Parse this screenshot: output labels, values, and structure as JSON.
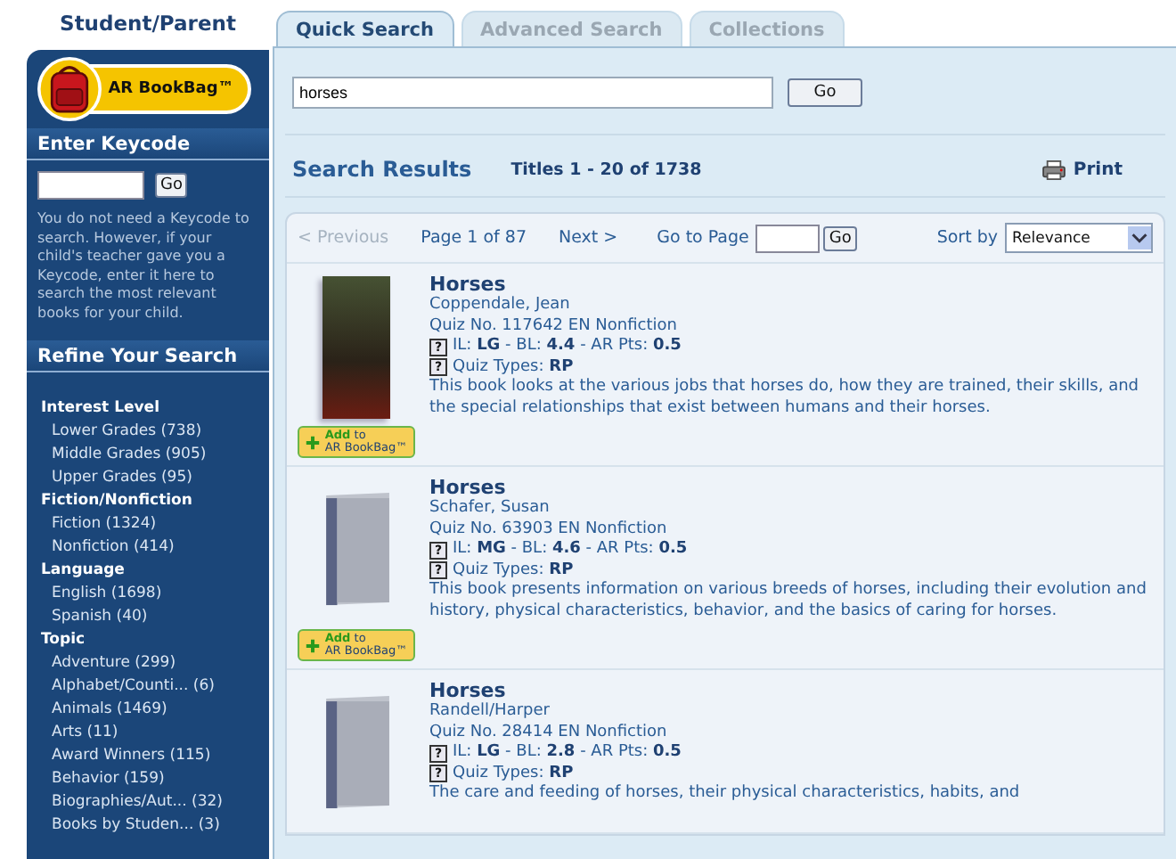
{
  "header": {
    "title": "Student/Parent"
  },
  "sidebar": {
    "bookbag": {
      "label": "AR BookBag™"
    },
    "keycode": {
      "title": "Enter Keycode",
      "button": "Go",
      "help": "You do not need a Keycode to search. However, if your child's teacher gave you a Keycode, enter it here to search the most relevant books for your child."
    },
    "refine": {
      "title": "Refine Your Search",
      "groups": [
        {
          "title": "Interest Level",
          "items": [
            "Lower Grades (738)",
            "Middle Grades (905)",
            "Upper Grades (95)"
          ]
        },
        {
          "title": "Fiction/Nonfiction",
          "items": [
            "Fiction (1324)",
            "Nonfiction (414)"
          ]
        },
        {
          "title": "Language",
          "items": [
            "English (1698)",
            "Spanish (40)"
          ]
        },
        {
          "title": "Topic",
          "items": [
            "Adventure (299)",
            "Alphabet/Counti... (6)",
            "Animals (1469)",
            "Arts (11)",
            "Award Winners (115)",
            "Behavior (159)",
            "Biographies/Aut... (32)",
            "Books by Studen... (3)"
          ]
        }
      ]
    }
  },
  "tabs": [
    {
      "label": "Quick Search",
      "selected": true
    },
    {
      "label": "Advanced Search",
      "selected": false
    },
    {
      "label": "Collections",
      "selected": false
    }
  ],
  "search": {
    "value": "horses",
    "button": "Go"
  },
  "results": {
    "title": "Search Results",
    "count": "Titles 1 - 20 of 1738",
    "print": "Print"
  },
  "pager": {
    "previous": {
      "label": "< Previous",
      "disabled": true
    },
    "page": "Page 1 of 87",
    "next": {
      "label": "Next >",
      "disabled": false
    },
    "goto_label": "Go to Page",
    "goto_button": "Go",
    "sort_label": "Sort by",
    "sort_value": "Relevance"
  },
  "books": [
    {
      "kind": "photo",
      "title": "Horses",
      "author": "Coppendale, Jean",
      "quiz": "Quiz No. 117642 EN Nonfiction",
      "il_help": "?",
      "levels": "IL: **LG** - BL: **4.4** - AR Pts: **0.5**",
      "types_help": "?",
      "types": "Quiz Types: **RP**",
      "description": "This book looks at the various jobs that horses do, how they are trained, their skills, and the special relationships that exist between humans and their horses.",
      "add_button": {
        "label": "Add",
        "suffix": "to",
        "target": "AR BookBag™"
      }
    },
    {
      "kind": "generic",
      "title": "Horses",
      "author": "Schafer, Susan",
      "quiz": "Quiz No. 63903 EN Nonfiction",
      "il_help": "?",
      "levels": "IL: **MG** - BL: **4.6** - AR Pts: **0.5**",
      "types_help": "?",
      "types": "Quiz Types: **RP**",
      "description": "This book presents information on various breeds of horses, including their evolution and history, physical characteristics, behavior, and the basics of caring for horses.",
      "add_button": {
        "label": "Add",
        "suffix": "to",
        "target": "AR BookBag™"
      }
    },
    {
      "kind": "generic",
      "title": "Horses",
      "author": "Randell/Harper",
      "quiz": "Quiz No. 28414 EN Nonfiction",
      "il_help": "?",
      "levels": "IL: **LG** - BL: **2.8** - AR Pts: **0.5**",
      "types_help": "?",
      "types": "Quiz Types: **RP**",
      "description": "The care and feeding of horses, their physical characteristics, habits, and"
    }
  ]
}
